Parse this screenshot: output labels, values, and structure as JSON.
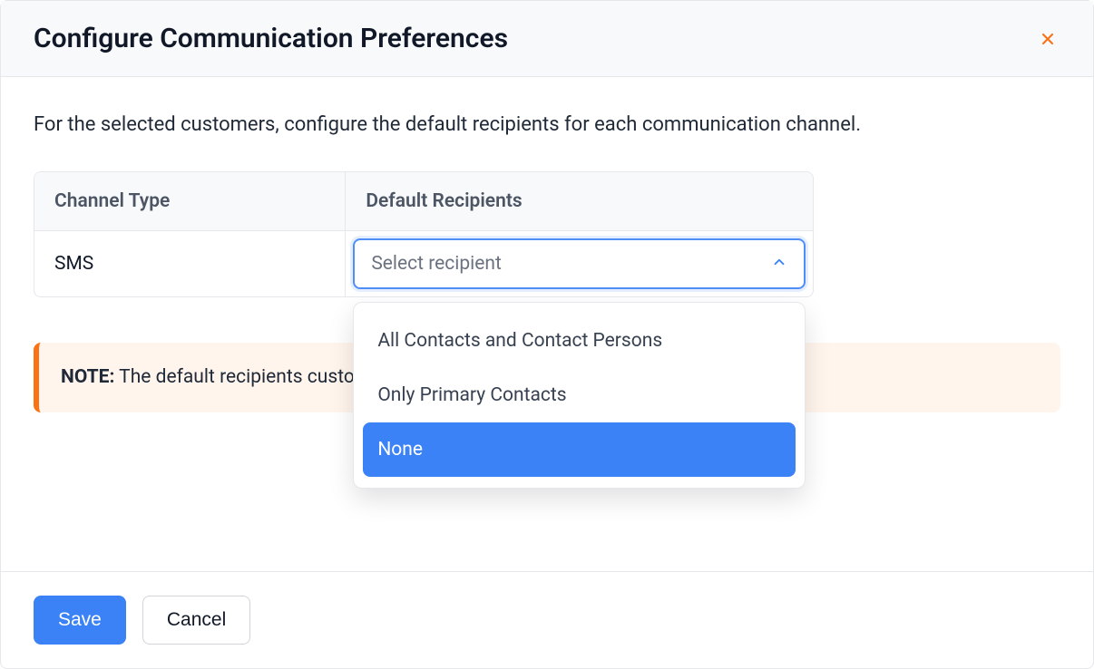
{
  "header": {
    "title": "Configure Communication Preferences"
  },
  "body": {
    "intro": "For the selected customers, configure the default recipients for each communication channel.",
    "table": {
      "headers": {
        "channel": "Channel Type",
        "recipients": "Default Recipients"
      },
      "rows": [
        {
          "channel": "SMS",
          "select": {
            "placeholder": "Select recipient",
            "options": [
              "All Contacts and Contact Persons",
              "Only Primary Contacts",
              "None"
            ],
            "selected": "None"
          }
        }
      ]
    },
    "note": {
      "label": "NOTE:",
      "text_before": " The default recipients ",
      "text_after": " customers only if their phone number is "
    }
  },
  "footer": {
    "save": "Save",
    "cancel": "Cancel"
  }
}
